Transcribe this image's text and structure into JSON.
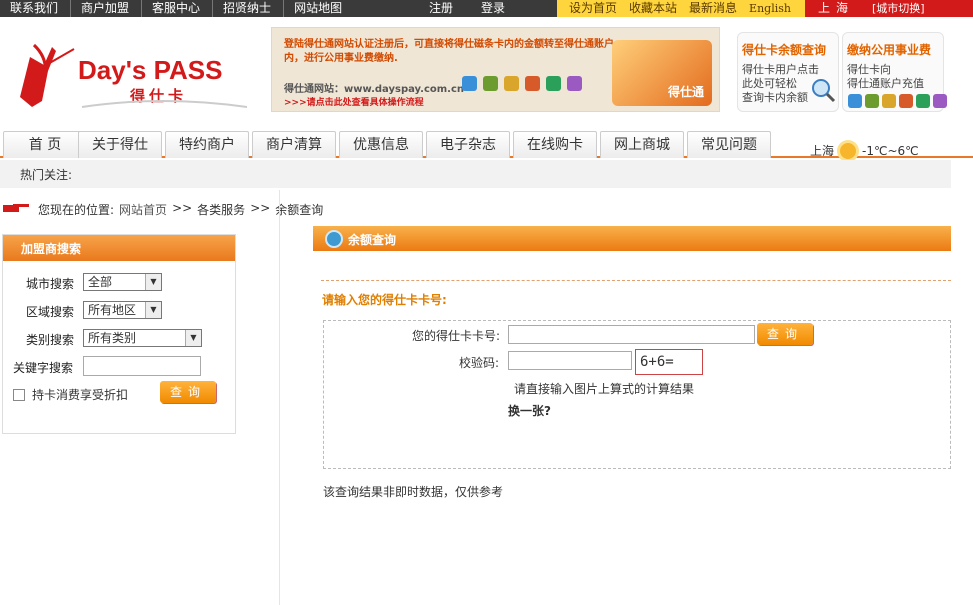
{
  "topbar": {
    "left_links": [
      "联系我们",
      "商户加盟",
      "客服中心",
      "招贤纳士",
      "网站地图"
    ],
    "auth_links": [
      "注册",
      "登录"
    ],
    "right_links": [
      "设为首页",
      "收藏本站",
      "最新消息",
      "English"
    ],
    "city": "上海",
    "city_switch": "[城市切换]"
  },
  "header": {
    "logo_en": "Day's PASS",
    "logo_cn": "得仕卡",
    "banner": {
      "line1": "登陆得仕通网站认证注册后，可直接将得仕磁条卡内的金额转至得仕通账户内，进行公用事业费缴纳.",
      "line2": "得仕通网站：www.dayspay.com.cn",
      "line3": ">>>请点击此处查看具体操作流程",
      "card_text": "得仕通"
    },
    "promo1": {
      "title": "得仕卡余额查询",
      "text": [
        "得仕卡用户点击",
        "此处可轻松",
        "查询卡内余额"
      ]
    },
    "promo2": {
      "title": "缴纳公用事业费",
      "text": [
        "得仕卡向",
        "得仕通账户充值"
      ]
    }
  },
  "nav": {
    "tabs": [
      "首  页",
      "关于得仕",
      "特约商户",
      "商户清算",
      "优惠信息",
      "电子杂志",
      "在线购卡",
      "网上商城",
      "常见问题"
    ],
    "weather_city": "上海",
    "weather_temp": "-1℃~6℃"
  },
  "hot": {
    "label": "热门关注:"
  },
  "breadcrumb": {
    "label": "您现在的位置:",
    "items": [
      "网站首页",
      ">>",
      "各类服务",
      ">>",
      "余额查询"
    ]
  },
  "merchant_search": {
    "title": "加盟商搜索",
    "city_label": "城市搜索",
    "city_value": "全部",
    "area_label": "区域搜索",
    "area_value": "所有地区",
    "category_label": "类别搜索",
    "category_value": "所有类别",
    "keyword_label": "关键字搜索",
    "keyword_value": "",
    "discount_label": "持卡消费享受折扣",
    "button": "查询"
  },
  "balance": {
    "title": "余额查询",
    "prompt": "请输入您的得仕卡卡号:",
    "card_label": "您的得仕卡卡号:",
    "card_value": "",
    "query_button": "查询",
    "code_label": "校验码:",
    "code_value": "",
    "captcha": "6+6=",
    "hint": "请直接输入图片上算式的计算结果",
    "refresh": "换一张?",
    "note": "该查询结果非即时数据，仅供参考"
  },
  "colors": {
    "accent": "#ec7a12",
    "topbar": "#3a3a3a",
    "yellow": "#ffd53d",
    "red": "#d21a1a"
  }
}
